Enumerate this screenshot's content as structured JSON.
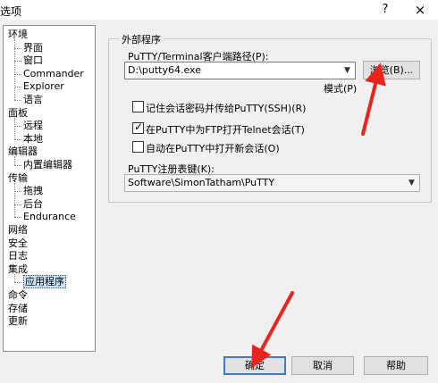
{
  "window": {
    "title": "选项",
    "help_glyph": "?",
    "close_glyph": "×"
  },
  "tree": {
    "items": [
      {
        "label": "环境",
        "level": 0
      },
      {
        "label": "界面",
        "level": 1
      },
      {
        "label": "窗口",
        "level": 1
      },
      {
        "label": "Commander",
        "level": 1
      },
      {
        "label": "Explorer",
        "level": 1
      },
      {
        "label": "语言",
        "level": 1
      },
      {
        "label": "面板",
        "level": 0
      },
      {
        "label": "远程",
        "level": 1
      },
      {
        "label": "本地",
        "level": 1
      },
      {
        "label": "编辑器",
        "level": 0
      },
      {
        "label": "内置编辑器",
        "level": 1
      },
      {
        "label": "传输",
        "level": 0
      },
      {
        "label": "拖拽",
        "level": 1
      },
      {
        "label": "后台",
        "level": 1
      },
      {
        "label": "Endurance",
        "level": 1
      },
      {
        "label": "网络",
        "level": 0
      },
      {
        "label": "安全",
        "level": 0
      },
      {
        "label": "日志",
        "level": 0
      },
      {
        "label": "集成",
        "level": 0
      },
      {
        "label": "应用程序",
        "level": 1,
        "selected": true
      },
      {
        "label": "命令",
        "level": 0
      },
      {
        "label": "存储",
        "level": 0
      },
      {
        "label": "更新",
        "level": 0
      }
    ]
  },
  "group": {
    "title": "外部程序",
    "path_label": "PuTTY/Terminal客户端路径(P):",
    "path_value": "D:\\putty64.exe",
    "browse_label": "浏览(B)...",
    "pattern_label": "模式(P)",
    "checkboxes": [
      {
        "label": "记住会话密码并传给PuTTY(SSH)(R)",
        "checked": false
      },
      {
        "label": "在PuTTY中为FTP打开Telnet会话(T)",
        "checked": true
      },
      {
        "label": "自动在PuTTY中打开新会话(O)",
        "checked": false
      }
    ],
    "registry_label": "PuTTY注册表键(K):",
    "registry_value": "Software\\SimonTatham\\PuTTY"
  },
  "footer": {
    "ok_label": "确定",
    "cancel_label": "取消",
    "help_label": "帮助"
  },
  "colors": {
    "annotation_arrow": "#e8241c",
    "selection": "#cde4f7",
    "default_button_border": "#3a7bd5"
  }
}
